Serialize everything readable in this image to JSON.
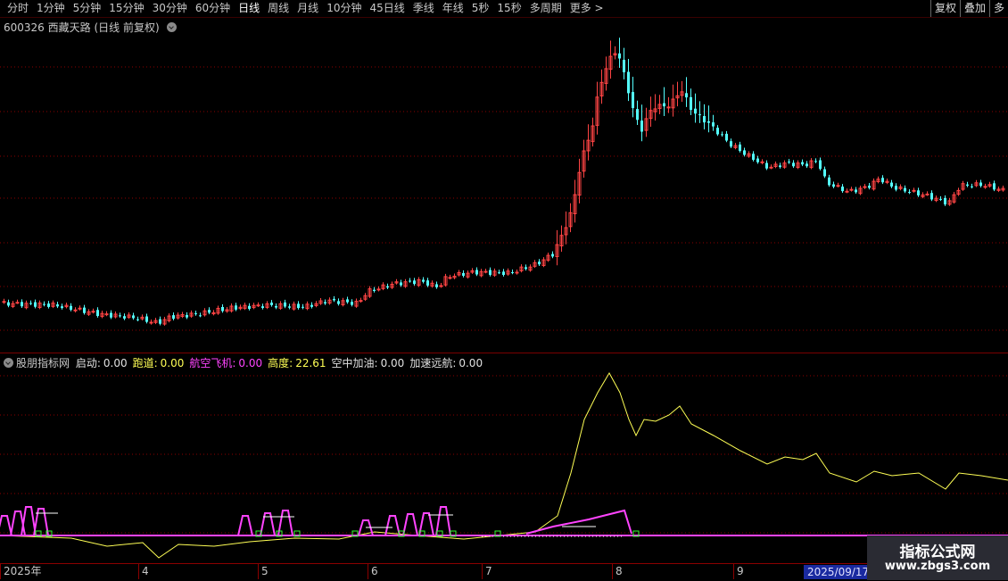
{
  "toolbar": {
    "periods": [
      {
        "label": "分时"
      },
      {
        "label": "1分钟"
      },
      {
        "label": "5分钟"
      },
      {
        "label": "15分钟"
      },
      {
        "label": "30分钟"
      },
      {
        "label": "60分钟"
      },
      {
        "label": "日线",
        "active": true
      },
      {
        "label": "周线"
      },
      {
        "label": "月线"
      },
      {
        "label": "10分钟"
      },
      {
        "label": "45日线"
      },
      {
        "label": "季线"
      },
      {
        "label": "年线"
      },
      {
        "label": "5秒"
      },
      {
        "label": "15秒"
      },
      {
        "label": "多周期"
      },
      {
        "label": "更多 >"
      }
    ],
    "right_buttons": [
      "复权",
      "叠加",
      "多"
    ]
  },
  "price_panel": {
    "code": "600326",
    "name": "西藏天路",
    "mode": "(日线 前复权)"
  },
  "indicator": {
    "name": "股朋指标网",
    "fields": [
      {
        "label": "启动:",
        "value": "0.00",
        "color": "#e0e0e0"
      },
      {
        "label": "跑道:",
        "value": "0.00",
        "color": "#ffff55"
      },
      {
        "label": "航空飞机:",
        "value": "0.00",
        "color": "#ff44ff"
      },
      {
        "label": "高度:",
        "value": "22.61",
        "color": "#ffff55"
      },
      {
        "label": "空中加油:",
        "value": "0.00",
        "color": "#e0e0e0"
      },
      {
        "label": "加速远航:",
        "value": "0.00",
        "color": "#e0e0e0"
      }
    ]
  },
  "time_axis": {
    "labels": [
      "2025年",
      "4",
      "5",
      "6",
      "7",
      "8",
      "9"
    ],
    "cursor_date": "2025/09/17/3"
  },
  "watermark": {
    "title": "指标公式网",
    "url": "www.zbgs3.com"
  },
  "colors": {
    "up": "#ff4444",
    "down": "#54ffff",
    "grid": "#8b0000",
    "height_line": "#ffff55",
    "plane_line": "#ff44ff"
  }
}
